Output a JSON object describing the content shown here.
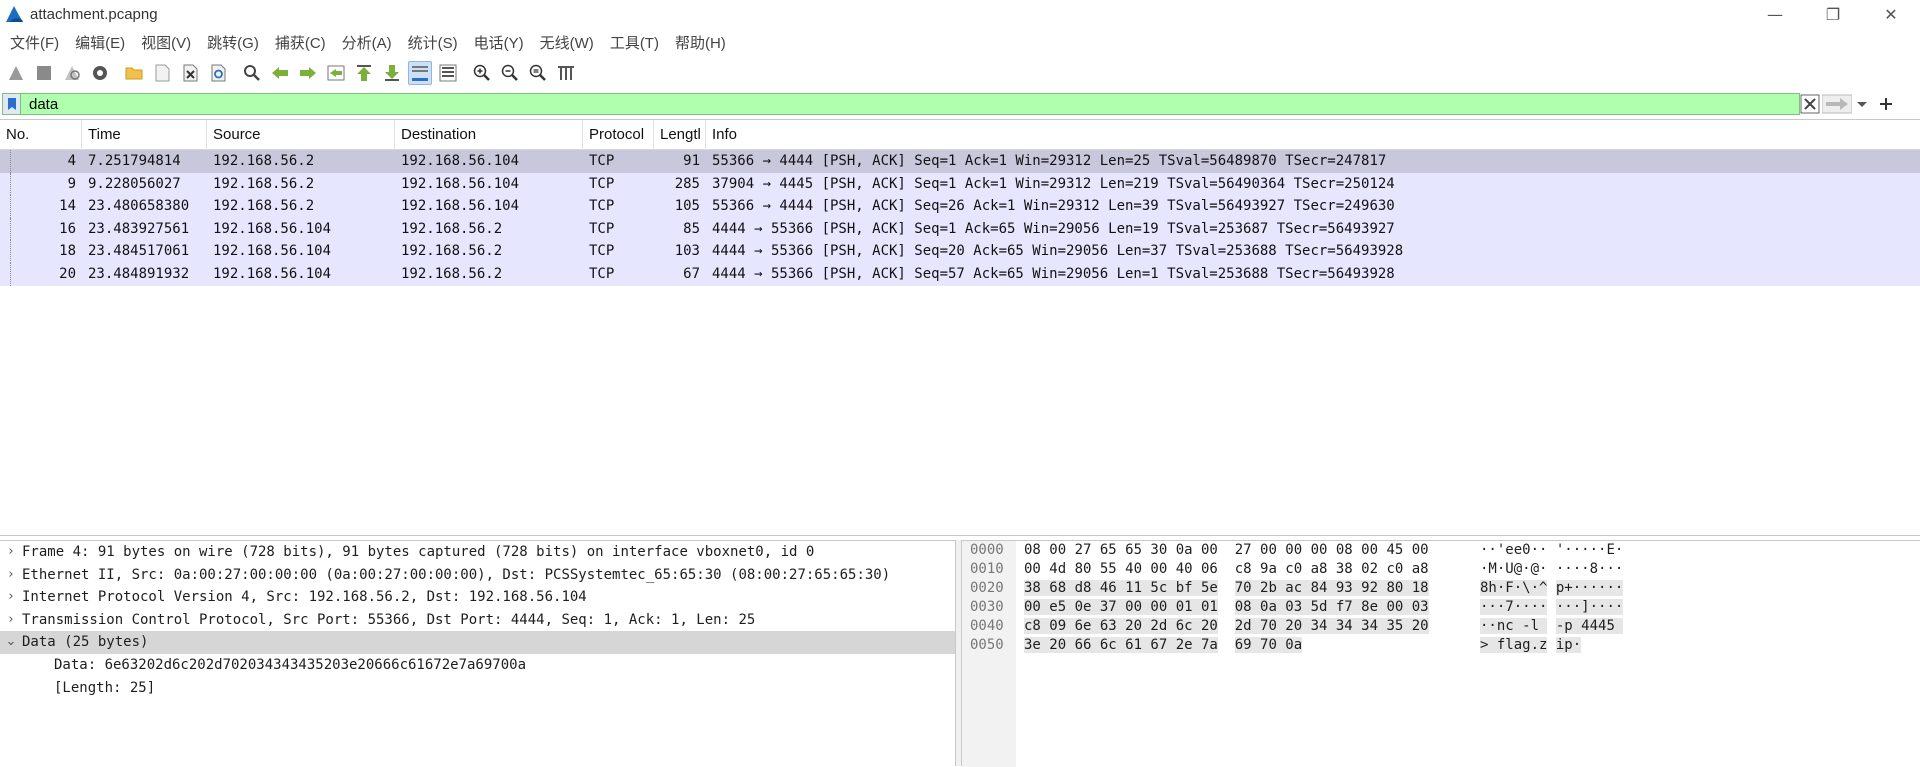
{
  "window": {
    "title": "attachment.pcapng",
    "minimize": "—",
    "maximize": "❐",
    "close": "✕"
  },
  "menu": [
    "文件(F)",
    "编辑(E)",
    "视图(V)",
    "跳转(G)",
    "捕获(C)",
    "分析(A)",
    "统计(S)",
    "电话(Y)",
    "无线(W)",
    "工具(T)",
    "帮助(H)"
  ],
  "toolbar": {
    "icons": [
      "start-capture-icon",
      "stop-capture-icon",
      "restart-capture-icon",
      "capture-options-icon",
      "open-file-icon",
      "save-file-icon",
      "close-file-icon",
      "reload-file-icon",
      "find-packet-icon",
      "go-back-icon",
      "go-forward-icon",
      "go-to-packet-icon",
      "go-first-packet-icon",
      "go-last-packet-icon",
      "autoscroll-icon",
      "colorize-icon",
      "zoom-in-icon",
      "zoom-out-icon",
      "zoom-normal-icon",
      "resize-columns-icon"
    ],
    "active": [
      "autoscroll-icon"
    ]
  },
  "filter": {
    "value": "data",
    "bg_color": "#afffaf"
  },
  "packet_list": {
    "columns": [
      "No.",
      "Time",
      "Source",
      "Destination",
      "Protocol",
      "Lengtl",
      "Info"
    ],
    "rows": [
      {
        "no": "4",
        "time": "7.251794814",
        "src": "192.168.56.2",
        "dst": "192.168.56.104",
        "proto": "TCP",
        "len": "91",
        "info": "55366 → 4444 [PSH, ACK] Seq=1 Ack=1 Win=29312 Len=25 TSval=56489870 TSecr=247817",
        "selected": true
      },
      {
        "no": "9",
        "time": "9.228056027",
        "src": "192.168.56.2",
        "dst": "192.168.56.104",
        "proto": "TCP",
        "len": "285",
        "info": "37904 → 4445 [PSH, ACK] Seq=1 Ack=1 Win=29312 Len=219 TSval=56490364 TSecr=250124",
        "selected": false
      },
      {
        "no": "14",
        "time": "23.480658380",
        "src": "192.168.56.2",
        "dst": "192.168.56.104",
        "proto": "TCP",
        "len": "105",
        "info": "55366 → 4444 [PSH, ACK] Seq=26 Ack=1 Win=29312 Len=39 TSval=56493927 TSecr=249630",
        "selected": false
      },
      {
        "no": "16",
        "time": "23.483927561",
        "src": "192.168.56.104",
        "dst": "192.168.56.2",
        "proto": "TCP",
        "len": "85",
        "info": "4444 → 55366 [PSH, ACK] Seq=1 Ack=65 Win=29056 Len=19 TSval=253687 TSecr=56493927",
        "selected": false
      },
      {
        "no": "18",
        "time": "23.484517061",
        "src": "192.168.56.104",
        "dst": "192.168.56.2",
        "proto": "TCP",
        "len": "103",
        "info": "4444 → 55366 [PSH, ACK] Seq=20 Ack=65 Win=29056 Len=37 TSval=253688 TSecr=56493928",
        "selected": false
      },
      {
        "no": "20",
        "time": "23.484891932",
        "src": "192.168.56.104",
        "dst": "192.168.56.2",
        "proto": "TCP",
        "len": "67",
        "info": "4444 → 55366 [PSH, ACK] Seq=57 Ack=65 Win=29056 Len=1 TSval=253688 TSecr=56493928",
        "selected": false
      }
    ],
    "row_color": "#e7e6ff",
    "selected_color": "#c8c7dc"
  },
  "details": {
    "rows": [
      {
        "arrow": "›",
        "text": "Frame 4: 91 bytes on wire (728 bits), 91 bytes captured (728 bits) on interface vboxnet0, id 0",
        "selected": false
      },
      {
        "arrow": "›",
        "text": "Ethernet II, Src: 0a:00:27:00:00:00 (0a:00:27:00:00:00), Dst: PCSSystemtec_65:65:30 (08:00:27:65:65:30)",
        "selected": false
      },
      {
        "arrow": "›",
        "text": "Internet Protocol Version 4, Src: 192.168.56.2, Dst: 192.168.56.104",
        "selected": false
      },
      {
        "arrow": "›",
        "text": "Transmission Control Protocol, Src Port: 55366, Dst Port: 4444, Seq: 1, Ack: 1, Len: 25",
        "selected": false
      },
      {
        "arrow": "⌄",
        "text": "Data (25 bytes)",
        "selected": true
      }
    ],
    "children": [
      "Data: 6e63202d6c202d702034343435203e20666c61672e7a69700a",
      "[Length: 25]"
    ]
  },
  "bytes": {
    "offsets": [
      "0000",
      "0010",
      "0020",
      "0030",
      "0040",
      "0050"
    ],
    "hex": [
      [
        "08 00 27 65 65 30 0a 00",
        "27 00 00 00 08 00 45 00"
      ],
      [
        "00 4d 80 55 40 00 40 06",
        "c8 9a c0 a8 38 02 c0 a8"
      ],
      [
        "38 68 d8 46 11 5c bf 5e",
        "70 2b ac 84 93 92 80 18"
      ],
      [
        "00 e5 0e 37 00 00 01 01",
        "08 0a 03 5d f7 8e 00 03"
      ],
      [
        "c8 09 6e 63 20 2d 6c 20",
        "2d 70 20 34 34 34 35 20"
      ],
      [
        "3e 20 66 6c 61 67 2e 7a",
        "69 70 0a"
      ]
    ],
    "ascii": [
      [
        "··'ee0··",
        "'·····E·"
      ],
      [
        "·M·U@·@·",
        "····8···"
      ],
      [
        "8h·F·\\·^",
        "p+······"
      ],
      [
        "···7····",
        "···]····"
      ],
      [
        "··nc -l ",
        "-p 4445 "
      ],
      [
        "> flag.z",
        "ip·"
      ]
    ]
  }
}
